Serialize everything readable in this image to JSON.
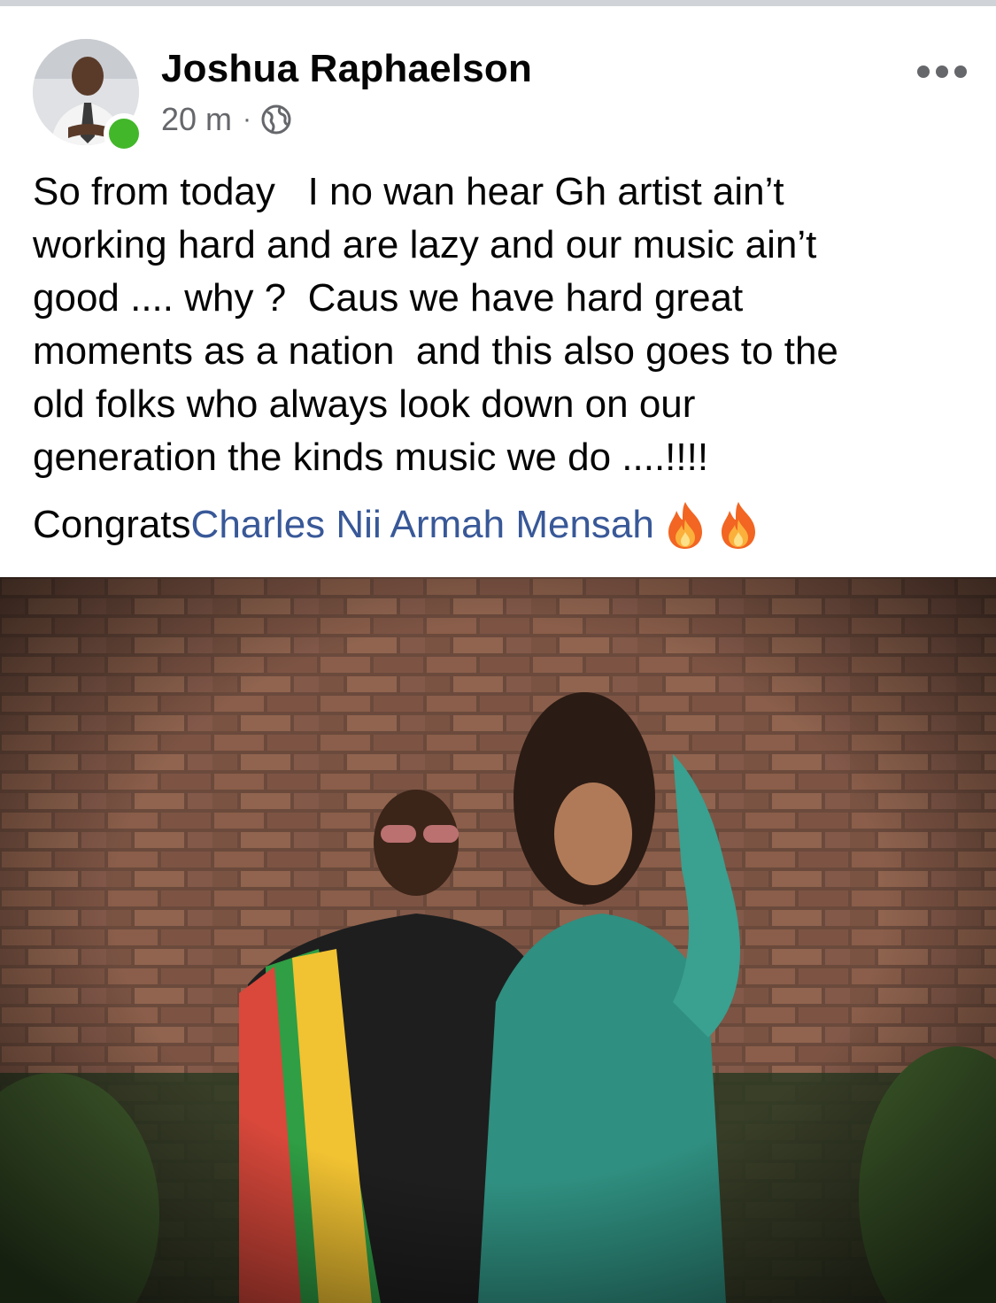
{
  "post": {
    "author": {
      "name": "Joshua Raphaelson",
      "online": true
    },
    "meta": {
      "time": "20 m",
      "separator": "·",
      "audience_icon": "globe-icon"
    },
    "more_icon": "more-options-icon",
    "text": "So from today   I no wan hear Gh artist ain’t\nworking hard and are lazy and our music ain’t\ngood .... why ?  Caus we have hard great\nmoments as a nation  and this also goes to the\nold folks who always look down on our\ngeneration the kinds music we do ....!!!!",
    "congrats": {
      "prefix": "Congrats",
      "mention": "Charles Nii Armah Mensah",
      "emojis": [
        "fire-icon",
        "fire-icon"
      ]
    },
    "photo": {
      "description_icon": "photo"
    }
  },
  "colors": {
    "link": "#385898",
    "online": "#42b72a",
    "meta": "#65676b",
    "text": "#050505"
  }
}
